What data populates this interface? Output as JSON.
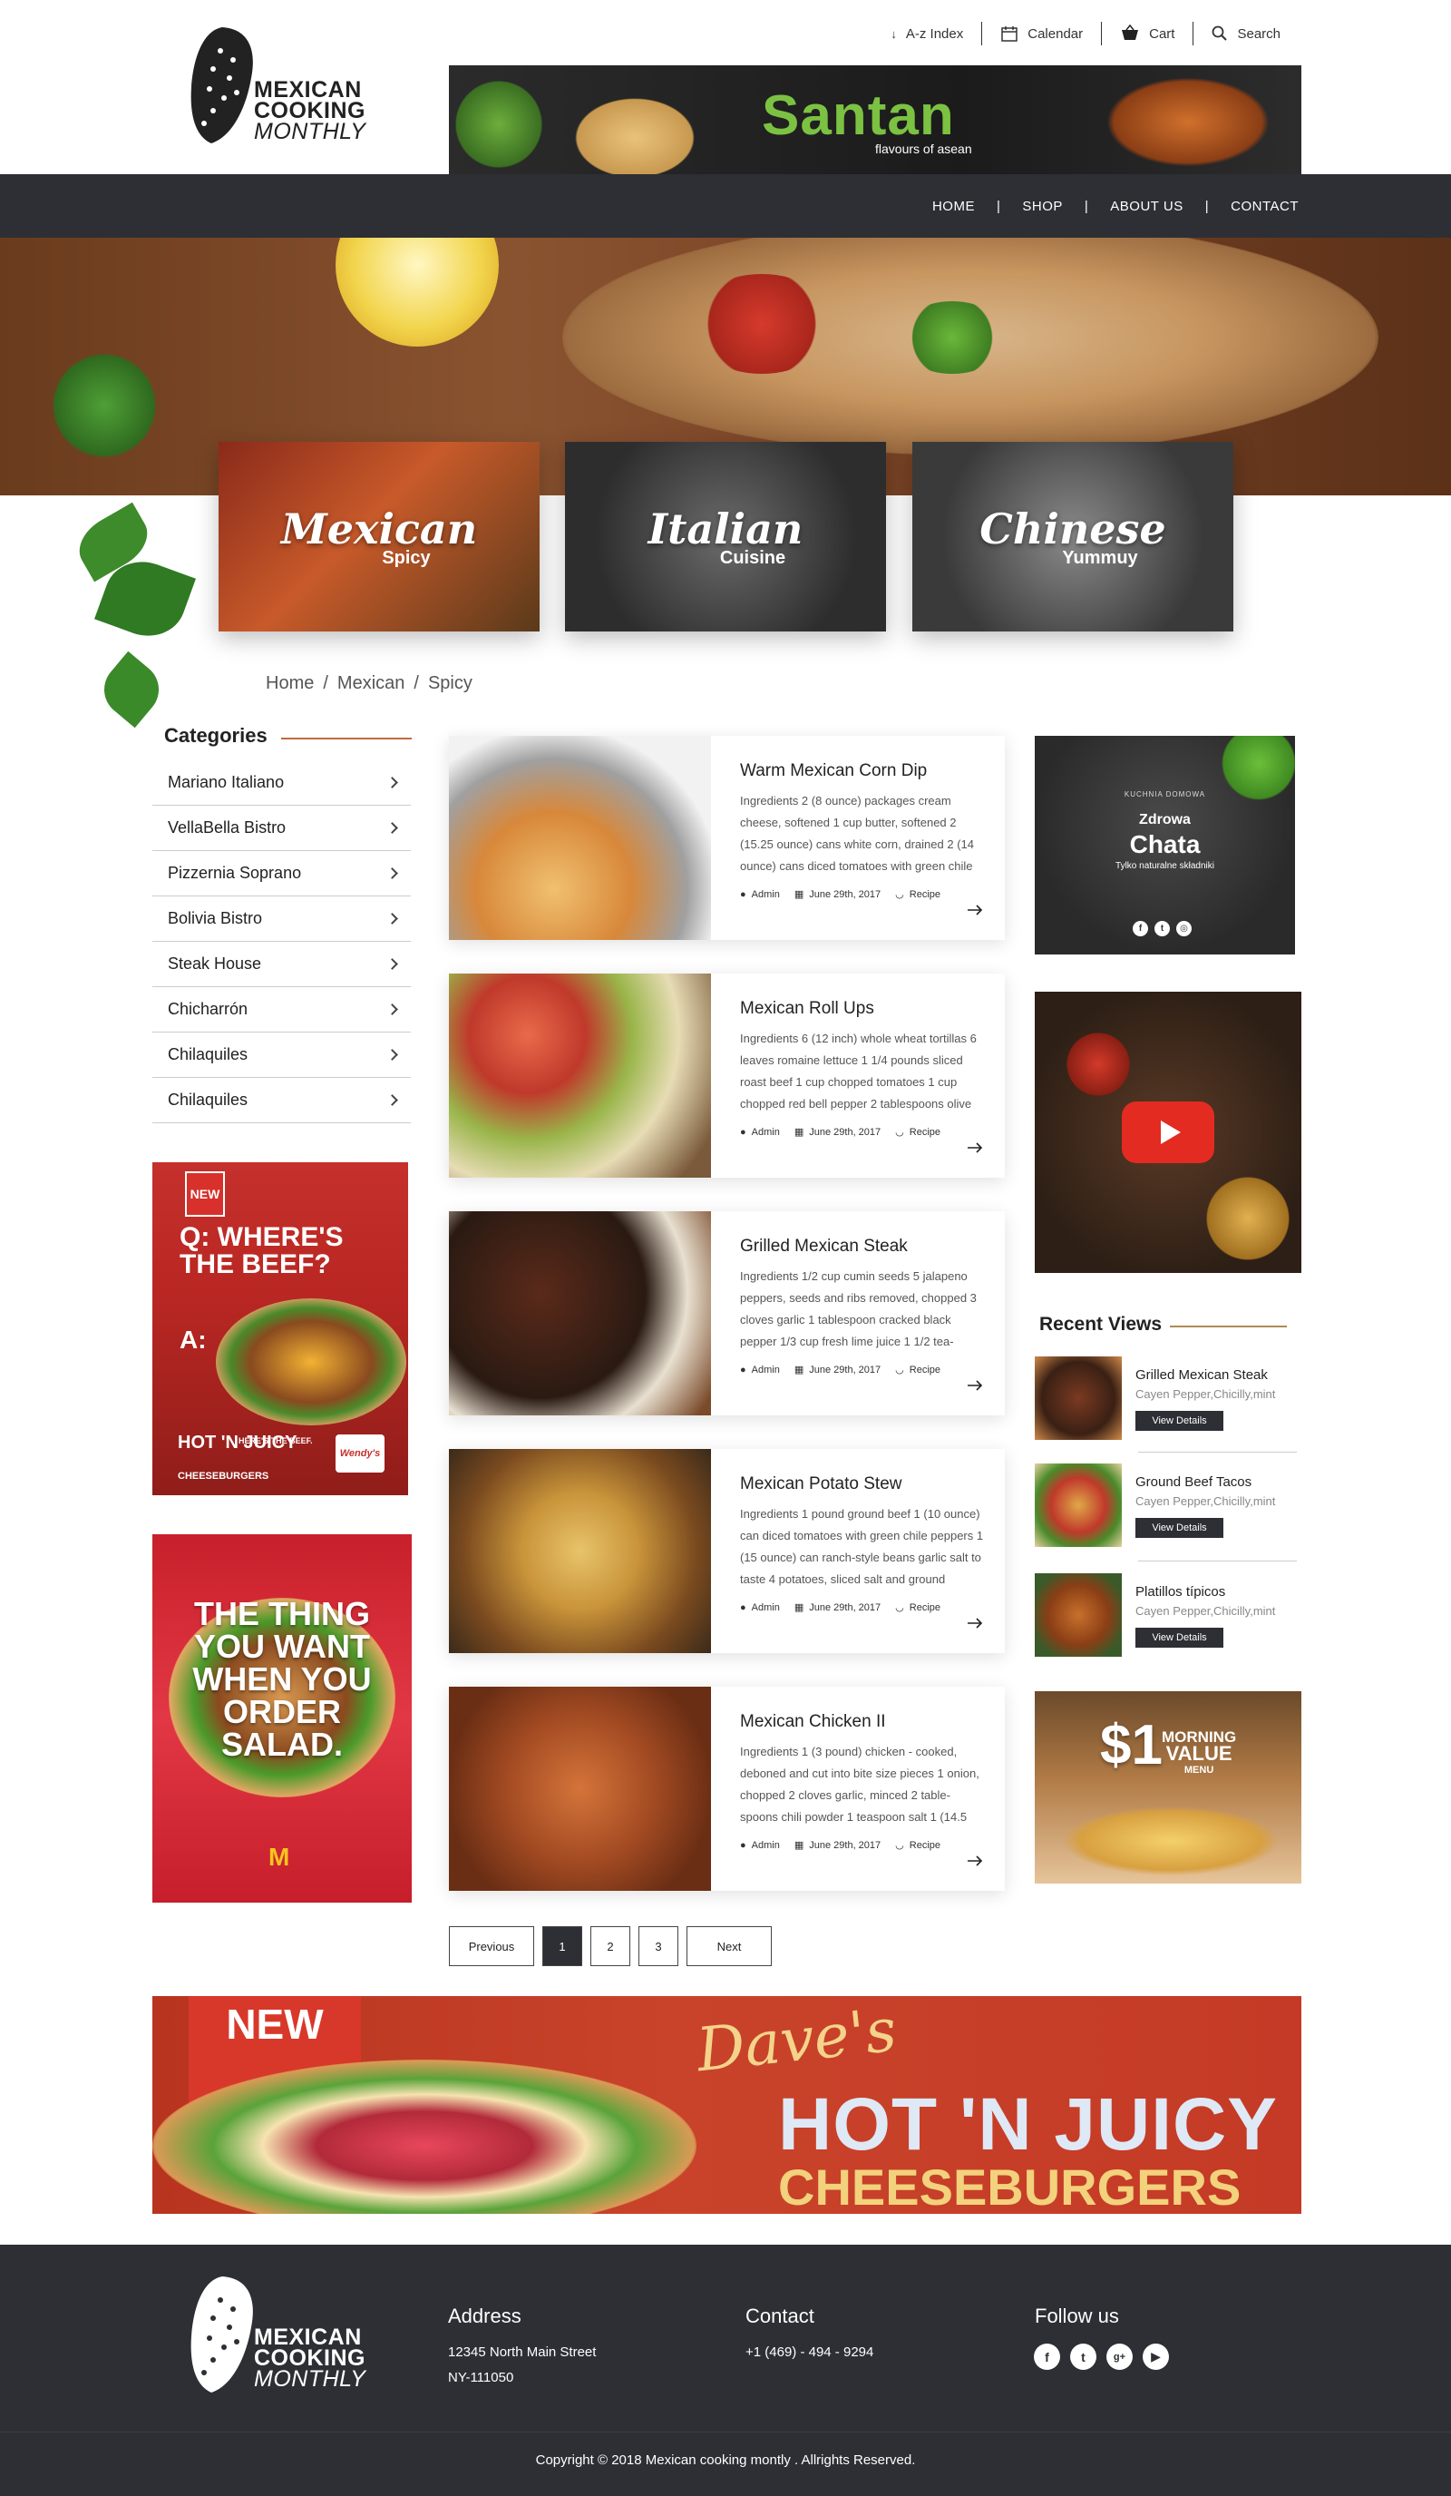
{
  "brand": {
    "line1": "MEXICAN",
    "line2": "COOKING",
    "line3": "MONTHLY"
  },
  "top_nav": [
    {
      "label": "A-z Index",
      "icon": "sort-az-icon"
    },
    {
      "label": "Calendar",
      "icon": "calendar-icon"
    },
    {
      "label": "Cart",
      "icon": "cart-icon"
    },
    {
      "label": "Search",
      "icon": "search-icon"
    }
  ],
  "top_banner": {
    "brand": "Santan",
    "tagline": "flavours of asean"
  },
  "main_nav": [
    "HOME",
    "SHOP",
    "ABOUT US",
    "CONTACT"
  ],
  "categories_tiles": [
    {
      "title": "Mexican",
      "subtitle": "Spicy"
    },
    {
      "title": "Italian",
      "subtitle": "Cuisine"
    },
    {
      "title": "Chinese",
      "subtitle": "Yummuy"
    }
  ],
  "breadcrumb": [
    "Home",
    "Mexican",
    "Spicy"
  ],
  "sidebar": {
    "heading": "Categories",
    "items": [
      "Mariano Italiano",
      "VellaBella Bistro",
      "Pizzernia Soprano",
      "Bolivia Bistro",
      "Steak House",
      "Chicharrón",
      "Chilaquiles",
      "Chilaquiles"
    ]
  },
  "ads": {
    "wendys": {
      "badge": "NEW",
      "headline": "Q: WHERE'S THE BEEF?",
      "answer": "A:",
      "product": "HOT 'N JUICY",
      "product_sub": "CHEESEBURGERS",
      "brand": "Wendy's",
      "small_head": "HERE'S THE BEEF."
    },
    "mcd": {
      "headline": "THE THING YOU WANT WHEN YOU ORDER SALAD."
    },
    "chata": {
      "top": "KUCHNIA DOMOWA",
      "line1": "Zdrowa",
      "line2": "Chata",
      "line3": "Tylko naturalne składniki"
    },
    "value": {
      "price": "$1",
      "line1": "MORNING",
      "line2": "VALUE",
      "line3": "MENU"
    },
    "dave": {
      "badge": "NEW",
      "script": "Dave's",
      "line1": "HOT 'N JUICY",
      "line2": "CHEESEBURGERS"
    }
  },
  "posts": [
    {
      "title": "Warm Mexican Corn Dip",
      "desc": "Ingredients 2 (8 ounce) packages cream cheese, softened 1 cup butter, softened 2 (15.25 ounce) cans white corn, drained 2 (14 ounce) cans diced tomatoes with green chile",
      "author": "Admin",
      "date": "June 29th, 2017",
      "type": "Recipe"
    },
    {
      "title": "Mexican Roll Ups",
      "desc": "Ingredients 6 (12 inch) whole wheat tortillas 6 leaves romaine lettuce 1 1/4 pounds sliced roast beef 1 cup chopped tomatoes 1 cup chopped red bell pepper 2 tablespoons olive",
      "author": "Admin",
      "date": "June 29th, 2017",
      "type": "Recipe"
    },
    {
      "title": "Grilled Mexican Steak",
      "desc": "Ingredients 1/2 cup cumin seeds 5 jalapeno peppers, seeds and ribs removed, chopped 3 cloves garlic 1 tablespoon cracked black pepper 1/3 cup fresh lime juice 1 1/2 tea-",
      "author": "Admin",
      "date": "June 29th, 2017",
      "type": "Recipe"
    },
    {
      "title": "Mexican Potato Stew",
      "desc": "Ingredients 1 pound ground beef 1 (10 ounce) can diced tomatoes with green chile peppers 1 (15 ounce) can ranch-style beans garlic salt to taste 4 potatoes, sliced salt and ground",
      "author": "Admin",
      "date": "June 29th, 2017",
      "type": "Recipe"
    },
    {
      "title": "Mexican Chicken II",
      "desc": "Ingredients 1 (3 pound) chicken - cooked, deboned and cut into bite size pieces 1 onion, chopped 2 cloves garlic, minced 2 table-spoons chili powder 1 teaspoon salt 1 (14.5",
      "author": "Admin",
      "date": "June 29th, 2017",
      "type": "Recipe"
    }
  ],
  "pager": {
    "prev": "Previous",
    "pages": [
      "1",
      "2",
      "3"
    ],
    "next": "Next",
    "active": "1"
  },
  "recent": {
    "heading": "Recent Views",
    "items": [
      {
        "name": "Grilled Mexican Steak",
        "sub": "Cayen Pepper,Chicilly,mint",
        "btn": "View Details"
      },
      {
        "name": "Ground Beef Tacos",
        "sub": "Cayen Pepper,Chicilly,mint",
        "btn": "View Details"
      },
      {
        "name": "Platillos típicos",
        "sub": "Cayen Pepper,Chicilly,mint",
        "btn": "View Details"
      }
    ]
  },
  "footer": {
    "address_h": "Address",
    "address_1": "12345 North Main Street",
    "address_2": "NY-111050",
    "contact_h": "Contact",
    "phone": "+1 (469) - 494 - 9294",
    "follow_h": "Follow us",
    "socials": [
      "facebook-icon",
      "twitter-icon",
      "google-plus-icon",
      "youtube-icon"
    ],
    "copyright": "Copyright  © 2018  Mexican cooking montly . Allrights Reserved."
  },
  "colors": {
    "dark": "#2d2f35",
    "accent": "#c06a3e",
    "gold": "#b08a54"
  }
}
